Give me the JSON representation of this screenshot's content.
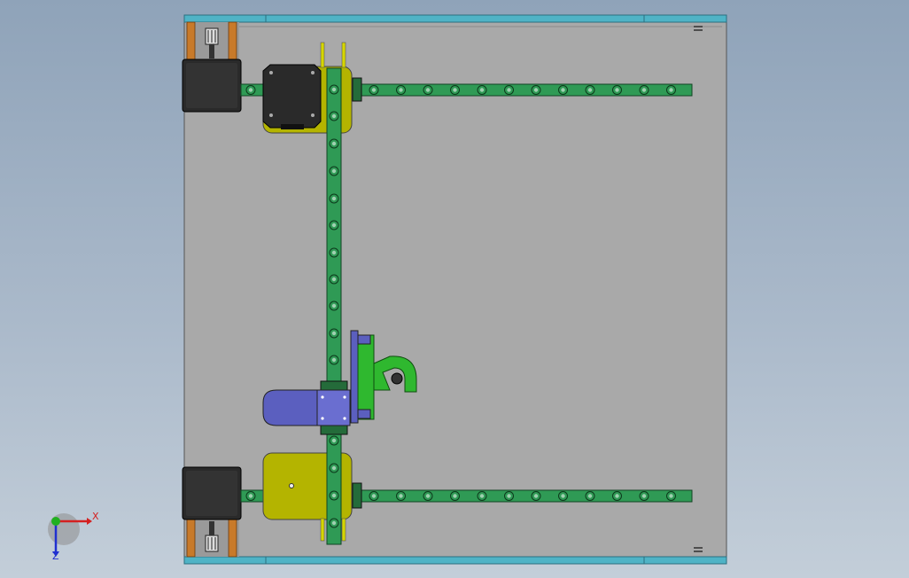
{
  "viewport": {
    "background_top": "#8fa3b9",
    "background_bottom": "#c3ced9"
  },
  "model": {
    "plate_color": "#a9a9a9",
    "rail_color": "#2f9a55",
    "rail_hole_color": "#1b6b3a",
    "motor_color": "#2a2a2a",
    "yellow_part_color": "#b4b400",
    "blue_part_color": "#5b5fbf",
    "bright_green_part_color": "#2fb82f",
    "frame_edge_color": "#4fb3c6",
    "belt_color": "#c87a2a"
  },
  "triad": {
    "x_label": "X",
    "z_label": "Z",
    "x_axis_color": "#d42020",
    "y_axis_color": "#20b020",
    "z_axis_color": "#2030d0"
  }
}
